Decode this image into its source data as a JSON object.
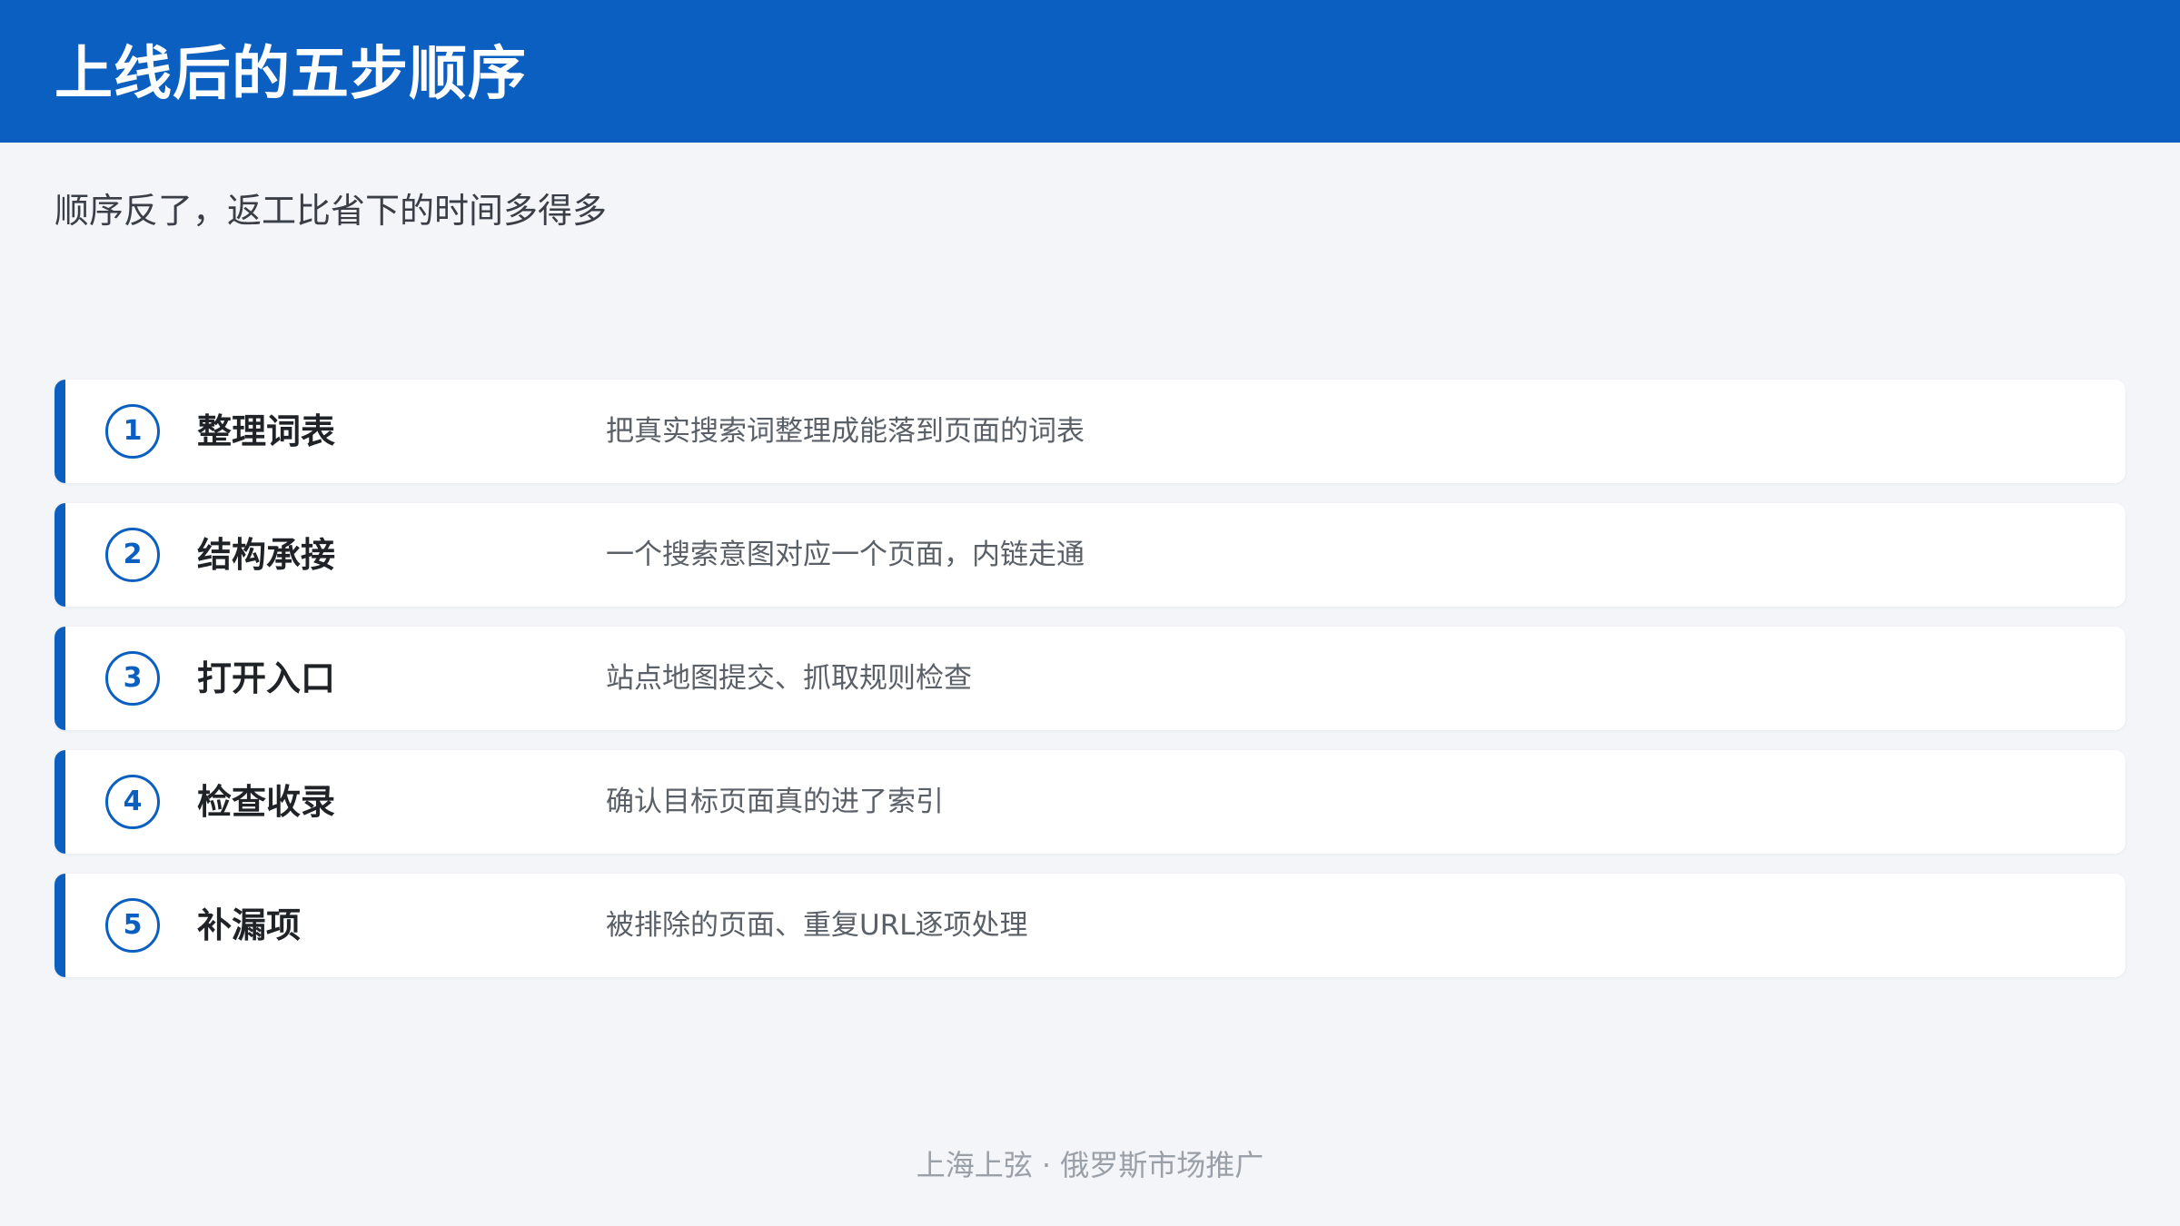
{
  "header": {
    "title": "上线后的五步顺序"
  },
  "subtitle": "顺序反了，返工比省下的时间多得多",
  "steps": [
    {
      "num": "1",
      "title": "整理词表",
      "desc": "把真实搜索词整理成能落到页面的词表"
    },
    {
      "num": "2",
      "title": "结构承接",
      "desc": "一个搜索意图对应一个页面，内链走通"
    },
    {
      "num": "3",
      "title": "打开入口",
      "desc": "站点地图提交、抓取规则检查"
    },
    {
      "num": "4",
      "title": "检查收录",
      "desc": "确认目标页面真的进了索引"
    },
    {
      "num": "5",
      "title": "补漏项",
      "desc": "被排除的页面、重复URL逐项处理"
    }
  ],
  "footer": "上海上弦 · 俄罗斯市场推广",
  "colors": {
    "accent": "#0b5fc0",
    "background": "#f3f5f9",
    "card": "#ffffff"
  }
}
